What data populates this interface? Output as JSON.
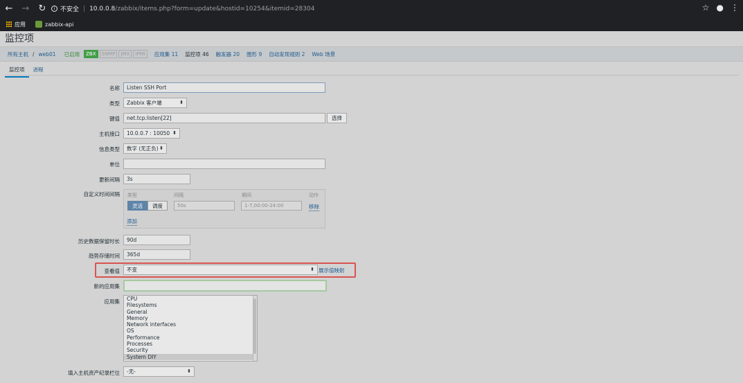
{
  "browser": {
    "info_label": "i",
    "insecure_label": "不安全",
    "url_host": "10.0.0.8",
    "url_path": "/zabbix/items.php?form=update&hostid=10254&itemid=28304",
    "bookmarks": [
      {
        "label": "应用"
      },
      {
        "label": "zabbix-api"
      }
    ]
  },
  "page": {
    "title": "监控项"
  },
  "host_nav": {
    "all_hosts": "所有主机",
    "slash": "/",
    "host": "web01",
    "status": "已启用",
    "badges": [
      "ZBX",
      "SNMP",
      "JMX",
      "IPMI"
    ],
    "applications": "应用集 11",
    "items": "监控项 46",
    "triggers": "触发器 20",
    "graphs": "图形 9",
    "discovery": "自动发现规则 2",
    "web": "Web 场景"
  },
  "tabs": [
    {
      "label": "监控项"
    },
    {
      "label": "进程"
    }
  ],
  "form": {
    "name_label": "名称",
    "name_value": "Listen SSH Port",
    "type_label": "类型",
    "type_value": "Zabbix 客户端",
    "key_label": "键值",
    "key_value": "net.tcp.listen[22]",
    "select_button": "选择",
    "interface_label": "主机接口",
    "interface_value": "10.0.0.7 : 10050",
    "info_type_label": "信息类型",
    "info_type_value": "数字 (无正负)",
    "units_label": "单位",
    "units_value": "",
    "update_interval_label": "更新间隔",
    "update_interval_value": "3s",
    "custom_intervals_label": "自定义时间间隔",
    "custom_intervals": {
      "col_type": "类型",
      "col_interval": "间隔",
      "col_period": "期间",
      "col_action": "动作",
      "flexible": "灵活",
      "scheduling": "调度",
      "interval_placeholder": "50s",
      "period_placeholder": "1-7,00:00-24:00",
      "remove": "移除",
      "add": "添加"
    },
    "history_label": "历史数据保留时长",
    "history_value": "90d",
    "trends_label": "趋势存储时间",
    "trends_value": "365d",
    "show_value_label": "查看值",
    "show_value_value": "不变",
    "show_value_mapping_link": "展示值映射",
    "new_app_label": "新的应用集",
    "new_app_value": "",
    "applications_label": "应用集",
    "applications_list": [
      "CPU",
      "Filesystems",
      "General",
      "Memory",
      "Network interfaces",
      "OS",
      "Performance",
      "Processes",
      "Security",
      "System DIY"
    ],
    "inventory_label": "填入主机资产纪录栏位",
    "inventory_value": "-无-"
  }
}
